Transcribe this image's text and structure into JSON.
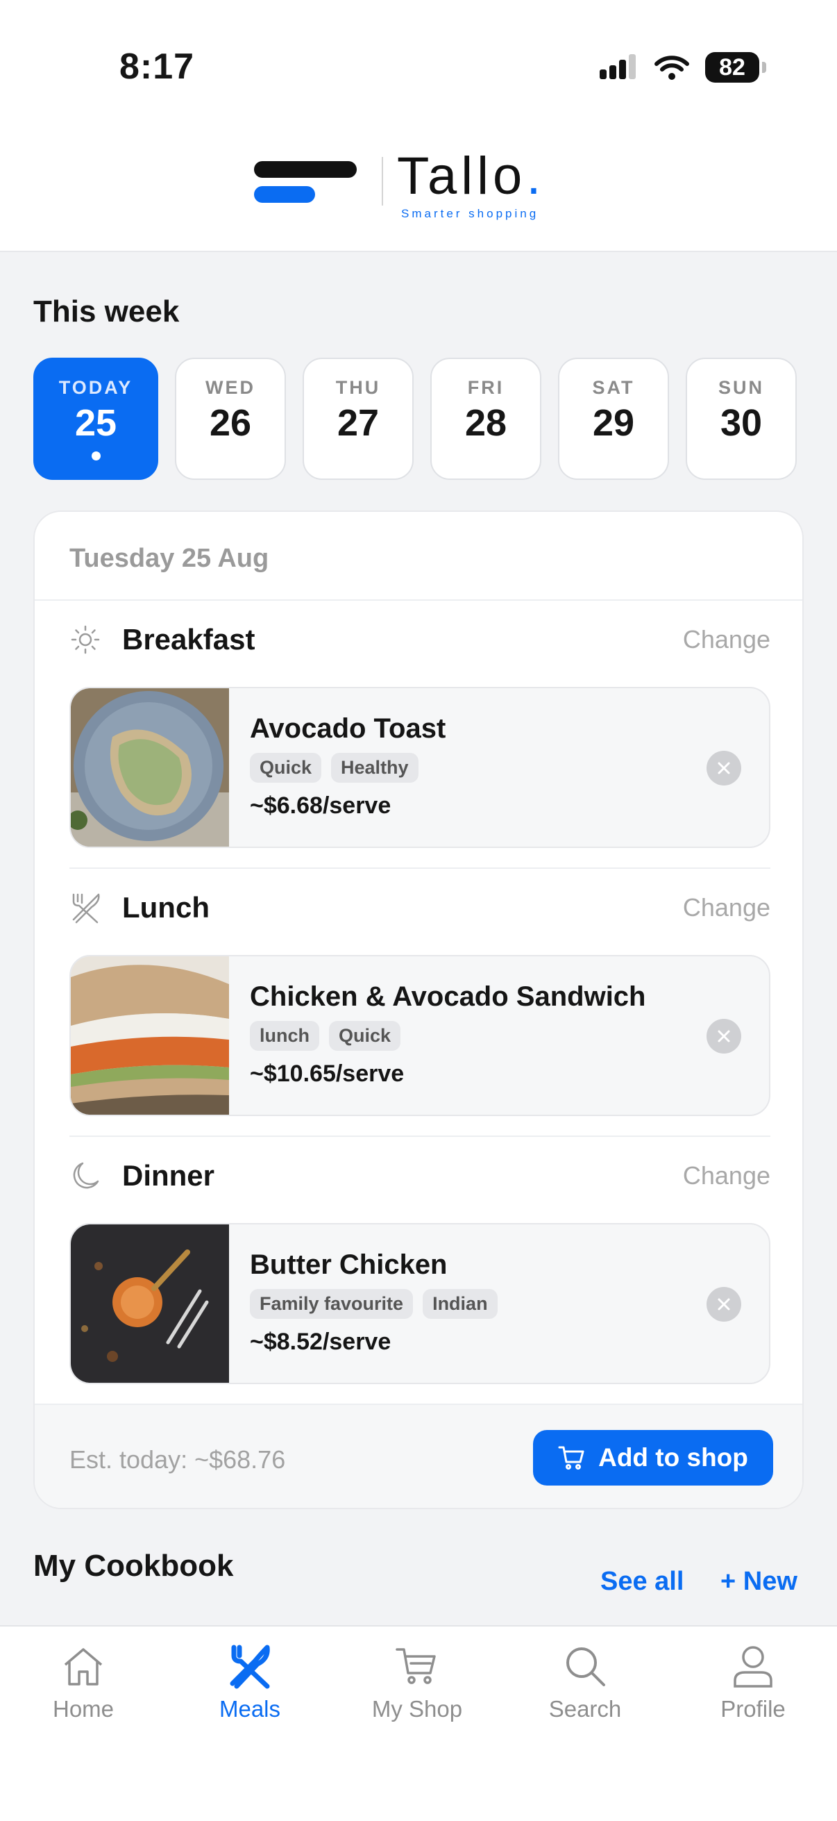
{
  "status": {
    "time": "8:17",
    "battery": "82"
  },
  "brand": {
    "name": "Tallo",
    "dot": ".",
    "tagline": "Smarter shopping"
  },
  "week": {
    "title": "This week",
    "days": [
      {
        "name": "TODAY",
        "num": "25"
      },
      {
        "name": "WED",
        "num": "26"
      },
      {
        "name": "THU",
        "num": "27"
      },
      {
        "name": "FRI",
        "num": "28"
      },
      {
        "name": "SAT",
        "num": "29"
      },
      {
        "name": "SUN",
        "num": "30"
      }
    ]
  },
  "plan": {
    "date": "Tuesday 25 Aug",
    "change_label": "Change",
    "meals": [
      {
        "type": "Breakfast",
        "icon": "sun-icon",
        "name": "Avocado Toast",
        "tags": [
          "Quick",
          "Healthy"
        ],
        "price": "~$6.68/serve"
      },
      {
        "type": "Lunch",
        "icon": "utensils-icon",
        "name": "Chicken & Avocado Sandwich",
        "tags": [
          "lunch",
          "Quick"
        ],
        "price": "~$10.65/serve"
      },
      {
        "type": "Dinner",
        "icon": "moon-icon",
        "name": "Butter Chicken",
        "tags": [
          "Family favourite",
          "Indian"
        ],
        "price": "~$8.52/serve"
      }
    ],
    "estimate": "Est. today: ~$68.76",
    "add_button": "Add to shop"
  },
  "cookbook": {
    "title": "My Cookbook",
    "see_all": "See all",
    "new": "+ New"
  },
  "nav": {
    "items": [
      {
        "label": "Home",
        "icon": "home-icon"
      },
      {
        "label": "Meals",
        "icon": "utensils-icon"
      },
      {
        "label": "My Shop",
        "icon": "cart-icon"
      },
      {
        "label": "Search",
        "icon": "search-icon"
      },
      {
        "label": "Profile",
        "icon": "profile-icon"
      }
    ]
  },
  "colors": {
    "accent": "#0a6cf2",
    "background": "#f2f3f5",
    "card": "#ffffff"
  }
}
